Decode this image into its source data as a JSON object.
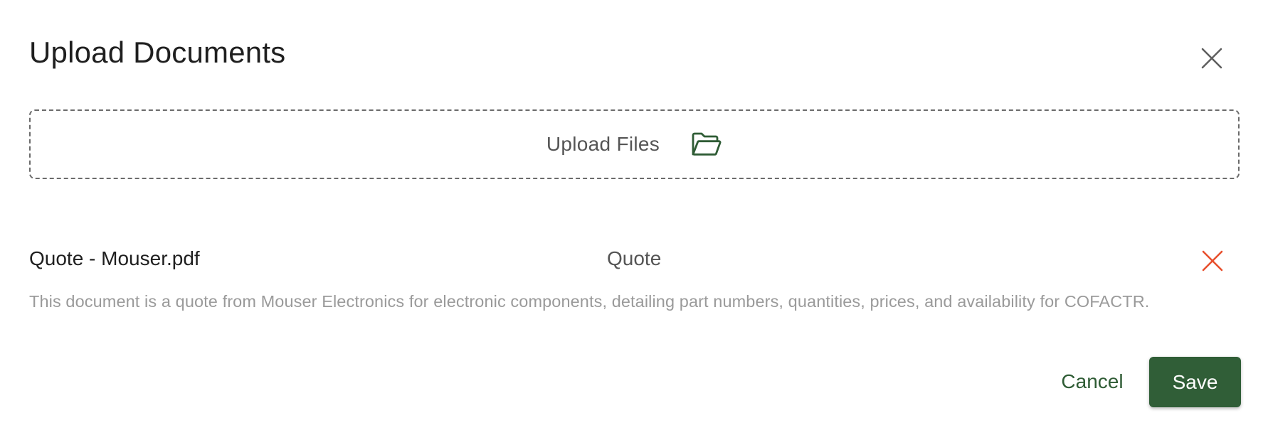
{
  "dialog": {
    "title": "Upload Documents",
    "close_icon": "close-icon"
  },
  "dropzone": {
    "label": "Upload Files",
    "icon": "folder-open-icon",
    "icon_color": "#2f5c35"
  },
  "files": [
    {
      "name": "Quote - Mouser.pdf",
      "type": "Quote",
      "description": "This document is a quote from Mouser Electronics for electronic components, detailing part numbers, quantities, prices, and availability for COFACTR.",
      "remove_icon": "remove-x-icon",
      "remove_color": "#e8502e"
    }
  ],
  "actions": {
    "cancel_label": "Cancel",
    "save_label": "Save"
  },
  "colors": {
    "primary": "#305e37",
    "danger": "#e8502e",
    "muted_text": "#9a9a9a"
  }
}
